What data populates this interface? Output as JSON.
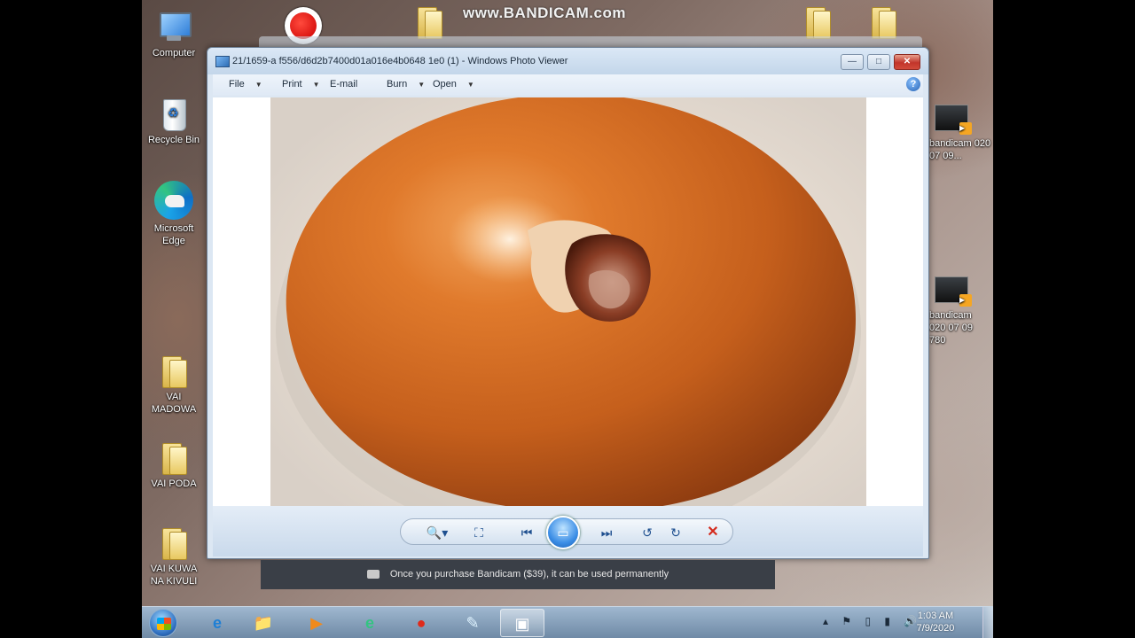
{
  "watermark": "www.BANDICAM.com",
  "desktop_icons": [
    {
      "id": "computer",
      "label": "Computer",
      "icon": "computer-icon"
    },
    {
      "id": "recycle-bin",
      "label": "Recycle Bin",
      "icon": "recycle-bin-icon"
    },
    {
      "id": "edge",
      "label": "Microsoft Edge",
      "icon": "edge-icon"
    },
    {
      "id": "vai-madowa",
      "label": "VAI MADOWA",
      "icon": "folder-icon"
    },
    {
      "id": "vai-poda",
      "label": "VAI PODA",
      "icon": "folder-icon"
    },
    {
      "id": "vai-kuwa",
      "label": "VAI KUWA NA KIVULI",
      "icon": "folder-icon"
    },
    {
      "id": "bandicam-1",
      "label": "bandicam 020 07 09...",
      "icon": "video-file-icon"
    },
    {
      "id": "bandicam-2",
      "label": "bandicam 020 07 09 780",
      "icon": "video-file-icon"
    }
  ],
  "window": {
    "title": "21/1659-a f556/d6d2b7400d01a016e4b0648 1e0 (1) - Windows Photo Viewer",
    "buttons": {
      "minimize": "—",
      "maximize": "□",
      "close": "✕"
    },
    "menu": [
      {
        "label": "File",
        "has_dropdown": true
      },
      {
        "label": "Print",
        "has_dropdown": true
      },
      {
        "label": "E-mail",
        "has_dropdown": false
      },
      {
        "label": "Burn",
        "has_dropdown": true
      },
      {
        "label": "Open",
        "has_dropdown": true
      }
    ],
    "help": "?",
    "controls": {
      "zoom": "🔍▾",
      "fit": "⛶",
      "previous": "⏮",
      "slideshow": "▭",
      "next": "⏭",
      "rotate_ccw": "↺",
      "rotate_cw": "↻",
      "delete": "✕"
    }
  },
  "notice": {
    "text": "Once you purchase Bandicam ($39), it can be used permanently"
  },
  "taskbar": {
    "apps": [
      {
        "name": "internet-explorer",
        "glyph": "e",
        "active": false
      },
      {
        "name": "file-explorer",
        "glyph": "📁",
        "active": false
      },
      {
        "name": "media-player",
        "glyph": "▶",
        "active": false
      },
      {
        "name": "edge",
        "glyph": "e",
        "active": false
      },
      {
        "name": "bandicam",
        "glyph": "●",
        "active": false
      },
      {
        "name": "notepad",
        "glyph": "✎",
        "active": false
      },
      {
        "name": "photo-viewer",
        "glyph": "▣",
        "active": true
      }
    ],
    "tray_icons": "▴ ⚑ ▯ ▮ 🔊",
    "time": "1:03 AM",
    "date": "7/9/2020"
  },
  "colors": {
    "accent": "#2f6fc0",
    "close": "#c2352b",
    "delete": "#d42a1c",
    "egg": "#c8631c"
  }
}
